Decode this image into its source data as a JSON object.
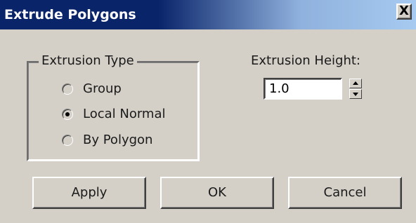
{
  "window": {
    "title": "Extrude Polygons",
    "close_icon": "close-icon",
    "close_glyph": "X",
    "colors": {
      "title_bar_start": "#0a246a",
      "title_bar_end": "#a6caf0",
      "dialog_background": "#d4d0c8"
    }
  },
  "extrusion_type": {
    "legend": "Extrusion Type",
    "options": [
      {
        "label": "Group",
        "selected": false,
        "enabled": false
      },
      {
        "label": "Local Normal",
        "selected": true,
        "enabled": true
      },
      {
        "label": "By Polygon",
        "selected": false,
        "enabled": false
      }
    ]
  },
  "extrusion_height": {
    "label": "Extrusion Height:",
    "value": "1.0",
    "spinner_icons": [
      "spinner-up-icon",
      "spinner-down-icon"
    ]
  },
  "buttons": {
    "apply": "Apply",
    "ok": "OK",
    "cancel": "Cancel"
  }
}
